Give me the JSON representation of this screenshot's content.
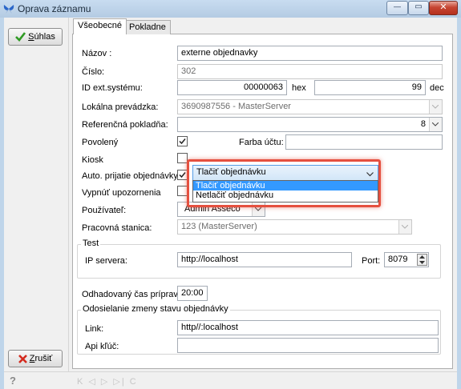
{
  "window": {
    "title": "Oprava záznamu",
    "min_glyph": "—",
    "max_glyph": "▭",
    "close_glyph": "✕"
  },
  "left": {
    "ok_label": "Súhlas",
    "cancel_label": "Zrušiť",
    "ok_icon": "checkmark-icon",
    "cancel_icon": "red-x-icon"
  },
  "tabs": [
    {
      "label": "Všeobecné",
      "active": true
    },
    {
      "label": "Pokladne",
      "active": false
    }
  ],
  "form": {
    "name_label": "Názov :",
    "name_value": "externe objednavky",
    "number_label": "Číslo:",
    "number_value": "302",
    "extid_label": "ID ext.systému:",
    "extid_value": "00000063",
    "hex_label": "hex",
    "dec_value": "99",
    "dec_label": "dec",
    "local_label": "Lokálna prevádzka:",
    "local_value": "3690987556 - MasterServer",
    "cash_label": "Referenčná pokladňa:",
    "cash_value": "8",
    "enabled_label": "Povolený",
    "enabled_checked": true,
    "color_label": "Farba účtu:",
    "color_value": "",
    "kiosk_label": "Kiosk",
    "kiosk_checked": false,
    "auto_label": "Auto. prijatie objednávky",
    "auto_checked": true,
    "auto_select_value": "Tlačiť objednávku",
    "auto_options": [
      "Tlačiť objednávku",
      "Netlačiť objednávku"
    ],
    "notify_label": "Vypnúť upozornenia",
    "notify_checked": false,
    "user_label": "Používateľ:",
    "user_value": "Admin Asseco",
    "station_label": "Pracovná stanica:",
    "station_value": "123 (MasterServer)",
    "test_group": "Test",
    "ip_label": "IP servera:",
    "ip_value": "http://localhost",
    "port_label": "Port:",
    "port_value": "8079",
    "prep_label": "Odhadovaný čas prípravy:",
    "prep_value": "20:00",
    "status_group": "Odosielanie zmeny stavu objednávky",
    "link_label": "Link:",
    "link_value": "http//:localhost",
    "apikey_label": "Api kľúč:",
    "apikey_value": ""
  },
  "status": {
    "help_glyph": "?",
    "nav_glyphs": "K ◁ ▷ ▷| C"
  },
  "colors": {
    "accent_highlight": "#e5503f",
    "selection": "#3399ff",
    "titlebar": "#bfd5ea"
  }
}
